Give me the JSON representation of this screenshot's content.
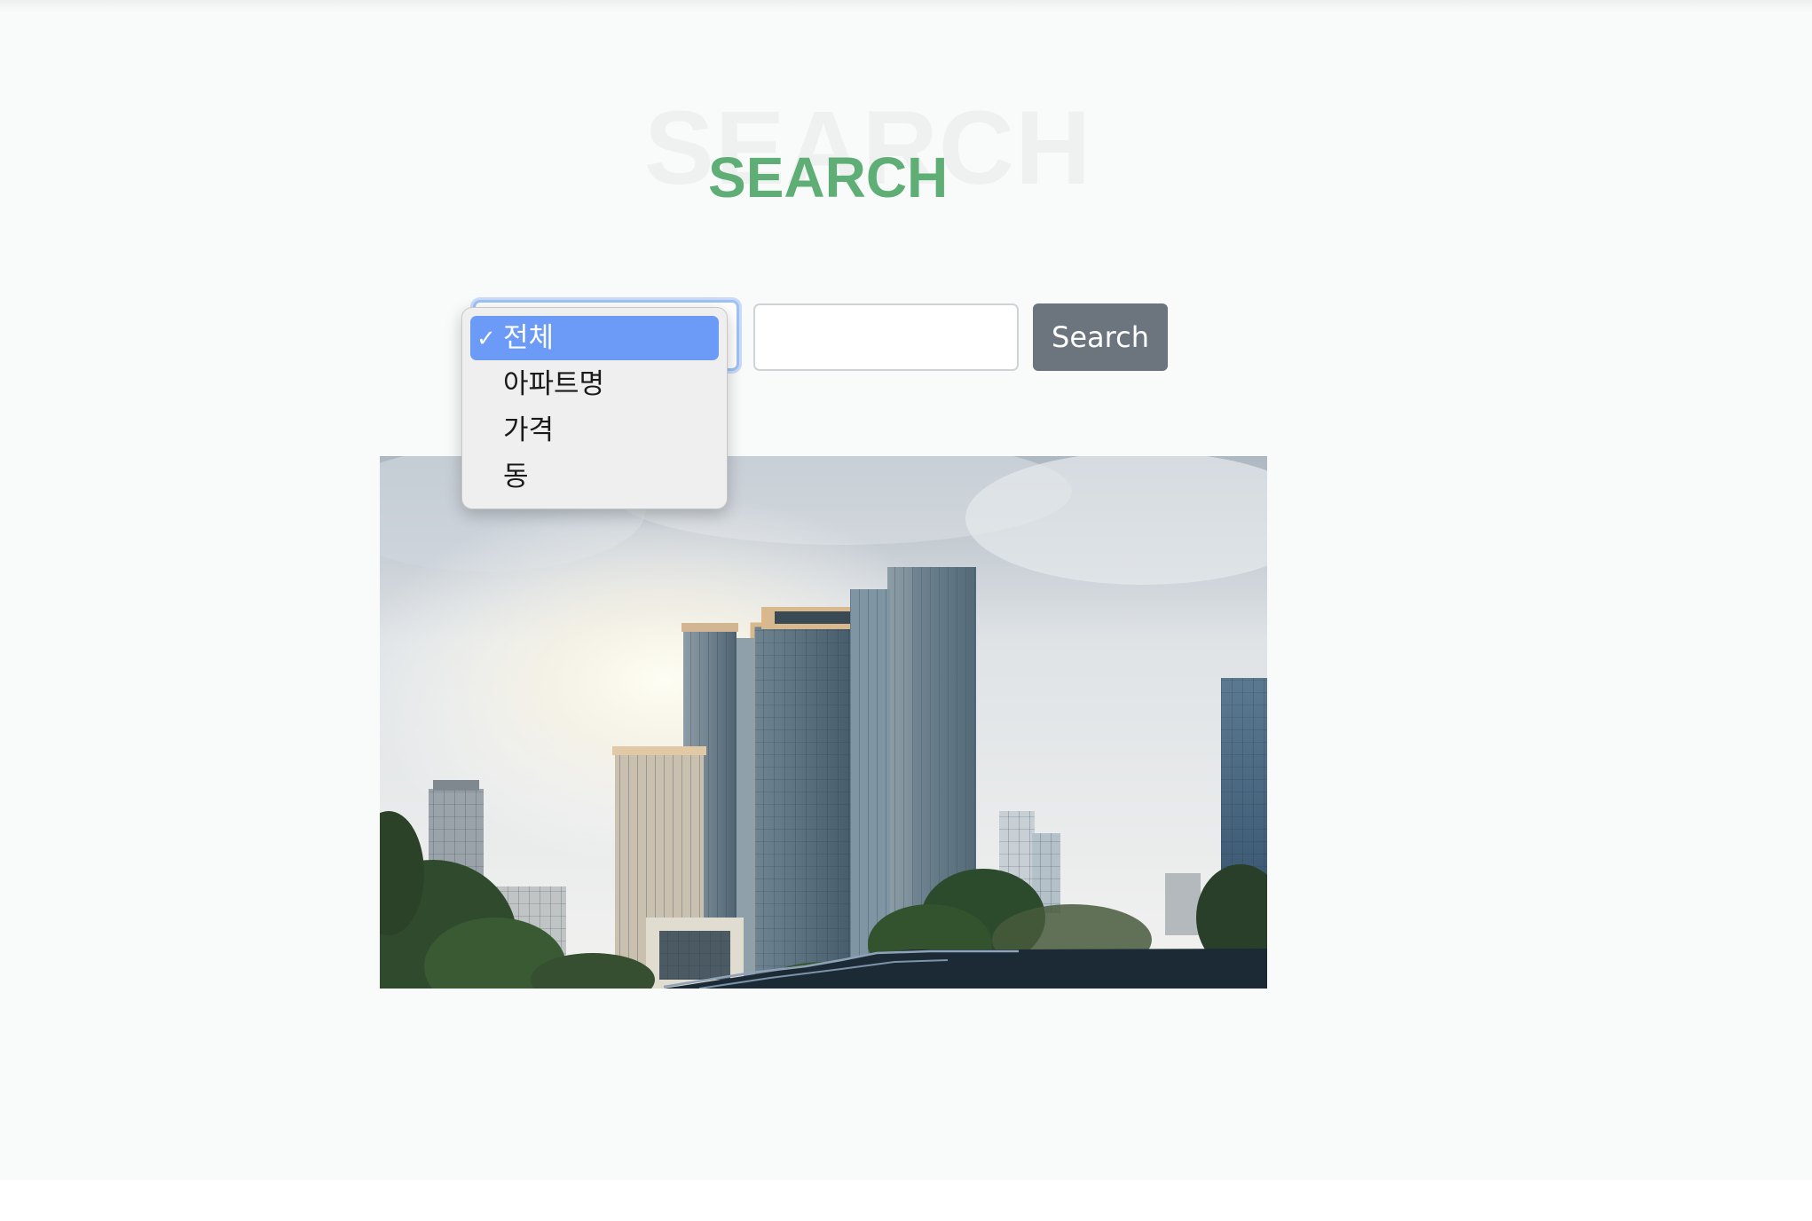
{
  "header": {
    "title_shadow": "SEARCH",
    "title": "SEARCH"
  },
  "search": {
    "category_selected": "전체",
    "options": [
      "전체",
      "아파트명",
      "가격",
      "동"
    ],
    "input_value": "",
    "input_placeholder": "",
    "button_label": "Search"
  },
  "colors": {
    "title_accent": "#5fae76",
    "button_bg": "#6c757d",
    "dropdown_highlight": "#6b9bf7"
  },
  "icons": {
    "check": "check-icon",
    "select_arrow": "chevron-down-icon"
  }
}
